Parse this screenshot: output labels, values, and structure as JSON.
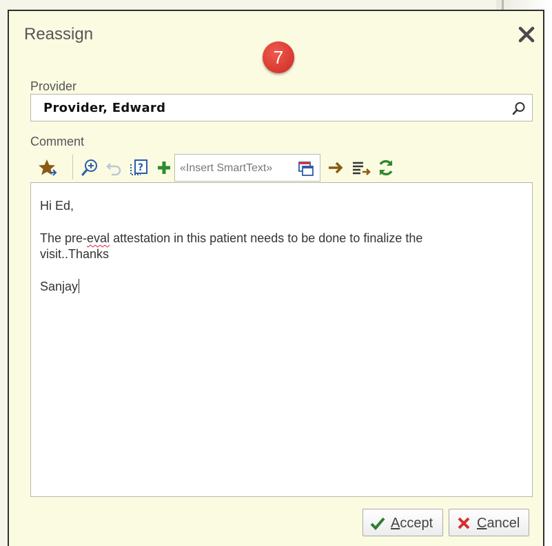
{
  "dialog": {
    "title": "Reassign",
    "step_badge": "7",
    "provider": {
      "label": "Provider",
      "value": "Provider, Edward"
    },
    "comment": {
      "label": "Comment",
      "smarttext_placeholder": "«Insert SmartText»",
      "lines": {
        "greeting": "Hi Ed,",
        "body_line1_a": "The pre-",
        "body_line1_b": "eval",
        "body_line1_c": " attestation in this patient needs to be done to finalize the",
        "body_line2": "visit..Thanks",
        "signature": "Sanjay"
      }
    },
    "buttons": {
      "accept_first": "A",
      "accept_rest": "ccept",
      "cancel_first": "C",
      "cancel_rest": "ancel"
    }
  },
  "colors": {
    "dialog_bg": "#fbfbe2",
    "badge": "#d8382e",
    "accept_check": "#2e7d32",
    "cancel_x": "#d32f2f",
    "toolbar_green": "#2e8b2e",
    "toolbar_blue": "#2a5caa",
    "toolbar_brown": "#8a5a14"
  },
  "icons": [
    "close-icon",
    "search-icon",
    "favorites-star-icon",
    "zoom-in-icon",
    "undo-icon",
    "smartphrase-help-icon",
    "add-icon",
    "smarttext-lookup-icon",
    "next-arrow-icon",
    "insert-list-icon",
    "refresh-icon",
    "checkmark-icon",
    "x-icon"
  ]
}
